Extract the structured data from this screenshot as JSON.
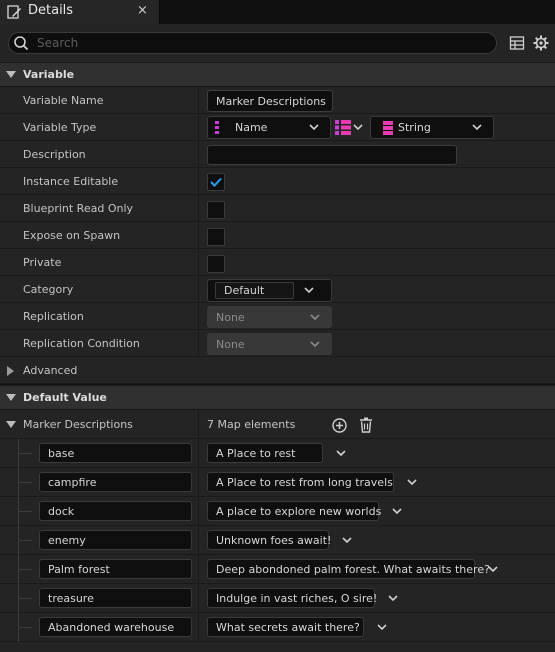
{
  "tab": {
    "title": "Details",
    "close": "×"
  },
  "search": {
    "placeholder": "Search",
    "value": ""
  },
  "sections": {
    "variable": "Variable",
    "default_value": "Default Value"
  },
  "variable": {
    "name_label": "Variable Name",
    "name_value": "Marker Descriptions",
    "type_label": "Variable Type",
    "key_type": "Name",
    "value_type": "String",
    "description_label": "Description",
    "description_value": "",
    "instance_editable_label": "Instance Editable",
    "instance_editable": true,
    "blueprint_read_only_label": "Blueprint Read Only",
    "blueprint_read_only": false,
    "expose_on_spawn_label": "Expose on Spawn",
    "expose_on_spawn": false,
    "private_label": "Private",
    "private": false,
    "category_label": "Category",
    "category_value": "Default",
    "replication_label": "Replication",
    "replication_value": "None",
    "replication_condition_label": "Replication Condition",
    "replication_condition_value": "None",
    "advanced_label": "Advanced"
  },
  "default_value": {
    "property_label": "Marker Descriptions",
    "count_text": "7 Map elements",
    "entries": [
      {
        "key": "base",
        "value": "A Place to rest"
      },
      {
        "key": "campfire",
        "value": "A Place to rest from long travels"
      },
      {
        "key": "dock",
        "value": "A place to explore new worlds"
      },
      {
        "key": "enemy",
        "value": "Unknown foes await!"
      },
      {
        "key": "Palm forest",
        "value": "Deep abondoned palm forest. What awaits there?"
      },
      {
        "key": "treasure",
        "value": "Indulge in vast riches, O sire!"
      },
      {
        "key": "Abandoned warehouse",
        "value": "What secrets await there?"
      }
    ]
  },
  "colors": {
    "accent_blue": "#2b9cf3",
    "name_type_pink": "#c83fd6",
    "string_type_magenta": "#e83bb2"
  }
}
